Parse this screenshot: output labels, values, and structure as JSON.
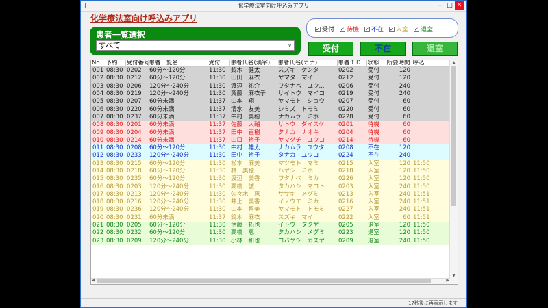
{
  "window": {
    "title": "化学療法室向け呼込みアプリ"
  },
  "app_title": "化学療法室向け呼込みアプリ",
  "patient_select": {
    "label": "患者一覧選択",
    "value": "すべて"
  },
  "filters": [
    {
      "label": "受付",
      "color": "#222222",
      "checked": true
    },
    {
      "label": "待機",
      "color": "#e02020",
      "checked": true
    },
    {
      "label": "不在",
      "color": "#1a30c8",
      "checked": true
    },
    {
      "label": "入室",
      "color": "#c8a840",
      "checked": true
    },
    {
      "label": "退室",
      "color": "#1b8a22",
      "checked": true
    }
  ],
  "buttons": {
    "accept": "受付",
    "absent": "不在",
    "leave": "退室"
  },
  "table": {
    "headers": [
      "No.",
      "予約",
      "受付番号",
      "患者一覧名",
      "受付",
      "患者氏名(漢字)",
      "患者氏名(カナ)",
      "患者ＩＤ",
      "状態",
      "所要時間",
      "呼込"
    ],
    "rows": [
      {
        "cls": "s-done",
        "no": "001",
        "rsv": "08:30",
        "rcpt": "0202",
        "list": "60分〜120分",
        "acc": "11:30",
        "kanji": "鈴木　健太",
        "kana": "スズキ　ケンタ",
        "pid": "0202",
        "status": "受付",
        "dur": "120",
        "call": ""
      },
      {
        "cls": "s-done",
        "no": "002",
        "rsv": "08:30",
        "rcpt": "0212",
        "list": "60分〜120分",
        "acc": "11:30",
        "kanji": "山田　麻衣",
        "kana": "ヤマダ　マイ",
        "pid": "0212",
        "status": "受付",
        "dur": "120",
        "call": ""
      },
      {
        "cls": "s-done",
        "no": "003",
        "rsv": "08:30",
        "rcpt": "0206",
        "list": "120分〜240分",
        "acc": "11:30",
        "kanji": "渡辺　祐介",
        "kana": "ワタナベ　ユウ...",
        "pid": "0206",
        "status": "受付",
        "dur": "240",
        "call": ""
      },
      {
        "cls": "s-done",
        "no": "004",
        "rsv": "08:30",
        "rcpt": "0219",
        "list": "120分〜240分",
        "acc": "11:30",
        "kanji": "斎藤　麻衣子",
        "kana": "サイトウ　マイコ",
        "pid": "0219",
        "status": "受付",
        "dur": "240",
        "call": ""
      },
      {
        "cls": "s-done",
        "no": "005",
        "rsv": "08:30",
        "rcpt": "0207",
        "list": "60分未満",
        "acc": "11:37",
        "kanji": "山本　翔",
        "kana": "ヤマモト　ショウ",
        "pid": "0207",
        "status": "受付",
        "dur": "60",
        "call": ""
      },
      {
        "cls": "s-done",
        "no": "006",
        "rsv": "08:30",
        "rcpt": "0220",
        "list": "60分未満",
        "acc": "11:37",
        "kanji": "清水　友美",
        "kana": "シミズ　トモミ",
        "pid": "0220",
        "status": "受付",
        "dur": "60",
        "call": ""
      },
      {
        "cls": "s-done",
        "no": "007",
        "rsv": "08:30",
        "rcpt": "0237",
        "list": "60分未満",
        "acc": "11:37",
        "kanji": "中村　美穂",
        "kana": "ナカムラ　ミホ",
        "pid": "0228",
        "status": "受付",
        "dur": "60",
        "call": ""
      },
      {
        "cls": "s-wait",
        "no": "008",
        "rsv": "08:30",
        "rcpt": "0201",
        "list": "60分未満",
        "acc": "11:37",
        "kanji": "佐藤　大輔",
        "kana": "サトウ　ダイスケ",
        "pid": "0201",
        "status": "待機",
        "dur": "60",
        "call": ""
      },
      {
        "cls": "s-wait",
        "no": "009",
        "rsv": "08:30",
        "rcpt": "0204",
        "list": "60分未満",
        "acc": "11:37",
        "kanji": "田中　直樹",
        "kana": "タナカ　ナオキ",
        "pid": "0204",
        "status": "待機",
        "dur": "60",
        "call": ""
      },
      {
        "cls": "s-wait",
        "no": "010",
        "rsv": "08:30",
        "rcpt": "0214",
        "list": "60分未満",
        "acc": "11:37",
        "kanji": "山口　裕子",
        "kana": "ヤマグチ　ユウコ",
        "pid": "0214",
        "status": "待機",
        "dur": "60",
        "call": ""
      },
      {
        "cls": "s-absent",
        "no": "011",
        "rsv": "08:30",
        "rcpt": "0208",
        "list": "60分〜120分",
        "acc": "11:30",
        "kanji": "中村　雄太",
        "kana": "ナカムラ　ユウタ",
        "pid": "0208",
        "status": "不在",
        "dur": "120",
        "call": ""
      },
      {
        "cls": "s-absent",
        "no": "012",
        "rsv": "08:30",
        "rcpt": "0233",
        "list": "120分〜240分",
        "acc": "11:30",
        "kanji": "田中　裕子",
        "kana": "タナカ　ユウコ",
        "pid": "0224",
        "status": "不在",
        "dur": "240",
        "call": ""
      },
      {
        "cls": "s-in",
        "no": "013",
        "rsv": "08:30",
        "rcpt": "0215",
        "list": "60分〜120分",
        "acc": "11:30",
        "kanji": "松本　麻美",
        "kana": "マツモト　マミ",
        "pid": "0215",
        "status": "入室",
        "dur": "120",
        "call": "11:50"
      },
      {
        "cls": "s-in",
        "no": "014",
        "rsv": "08:30",
        "rcpt": "0218",
        "list": "60分〜120分",
        "acc": "11:30",
        "kanji": "林　美穂",
        "kana": "ハヤシ　ミホ",
        "pid": "0218",
        "status": "入室",
        "dur": "120",
        "call": "11:50"
      },
      {
        "cls": "s-in",
        "no": "015",
        "rsv": "08:30",
        "rcpt": "0235",
        "list": "60分〜120分",
        "acc": "11:30",
        "kanji": "渡辺　美香",
        "kana": "ワタナベ　ミカ",
        "pid": "0226",
        "status": "入室",
        "dur": "120",
        "call": "11:50"
      },
      {
        "cls": "s-in",
        "no": "016",
        "rsv": "08:30",
        "rcpt": "0203",
        "list": "120分〜240分",
        "acc": "11:30",
        "kanji": "高橋　誠",
        "kana": "タカハシ　マコト",
        "pid": "0203",
        "status": "入室",
        "dur": "240",
        "call": "11:50"
      },
      {
        "cls": "s-in",
        "no": "017",
        "rsv": "08:30",
        "rcpt": "0213",
        "list": "120分〜240分",
        "acc": "11:30",
        "kanji": "佐々木　恵",
        "kana": "ササキ　メグミ",
        "pid": "0213",
        "status": "入室",
        "dur": "240",
        "call": "11:51"
      },
      {
        "cls": "s-in",
        "no": "018",
        "rsv": "08:30",
        "rcpt": "0216",
        "list": "120分〜240分",
        "acc": "11:30",
        "kanji": "井上　美香",
        "kana": "イノウエ　ミカ",
        "pid": "0216",
        "status": "入室",
        "dur": "240",
        "call": "11:51"
      },
      {
        "cls": "s-in",
        "no": "019",
        "rsv": "08:30",
        "rcpt": "0236",
        "list": "120分〜240分",
        "acc": "11:30",
        "kanji": "山本　智美",
        "kana": "ヤマモト　トモミ",
        "pid": "0227",
        "status": "入室",
        "dur": "240",
        "call": "11:51"
      },
      {
        "cls": "s-in",
        "no": "020",
        "rsv": "08:30",
        "rcpt": "0231",
        "list": "60分未満",
        "acc": "11:37",
        "kanji": "鈴木　麻衣",
        "kana": "スズキ　マイ",
        "pid": "0222",
        "status": "入室",
        "dur": "60",
        "call": "11:51"
      },
      {
        "cls": "s-leave",
        "no": "021",
        "rsv": "08:30",
        "rcpt": "0205",
        "list": "60分〜120分",
        "acc": "11:30",
        "kanji": "伊藤　拓也",
        "kana": "イトウ　タクヤ",
        "pid": "0205",
        "status": "退室",
        "dur": "120",
        "call": "11:50"
      },
      {
        "cls": "s-leave",
        "no": "022",
        "rsv": "08:30",
        "rcpt": "0232",
        "list": "60分〜120分",
        "acc": "11:30",
        "kanji": "高橋　恵",
        "kana": "タカハシ　メグミ",
        "pid": "0223",
        "status": "退室",
        "dur": "120",
        "call": "11:50"
      },
      {
        "cls": "s-leave",
        "no": "023",
        "rsv": "08:30",
        "rcpt": "0209",
        "list": "120分〜240分",
        "acc": "11:30",
        "kanji": "小林　和也",
        "kana": "コバヤシ　カズヤ",
        "pid": "0209",
        "status": "退室",
        "dur": "240",
        "call": "11:50"
      }
    ]
  },
  "status_bar": "17秒後に再表示します"
}
